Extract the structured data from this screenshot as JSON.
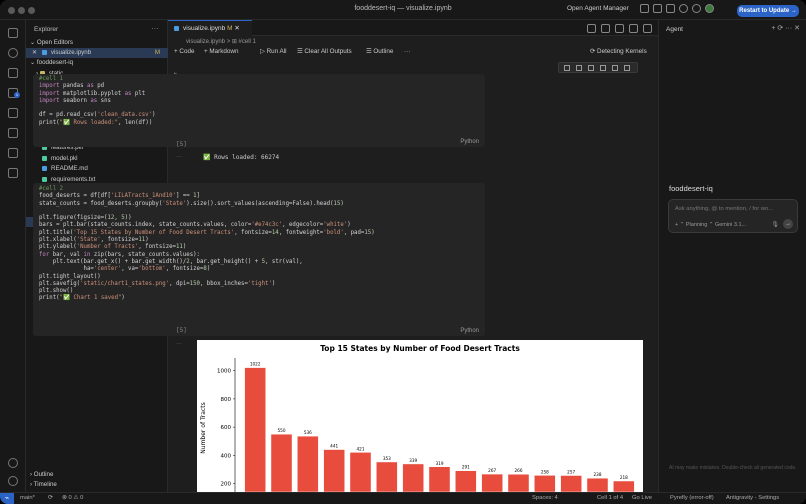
{
  "window_title": "fooddesert-iq — visualize.ipynb",
  "titlebar": {
    "agent_manager": "Open Agent Manager",
    "restart_button": "Restart to Update →"
  },
  "explorer": {
    "header": "Explorer",
    "open_editors": "Open Editors",
    "open_file": "visualize.ipynb",
    "open_file_badge": "M",
    "project": "fooddesert-iq",
    "items": [
      {
        "label": "static",
        "color": "#c8b560"
      },
      {
        "label": "templates",
        "color": "#c8b560"
      },
      {
        "label": "venv",
        "color": "#c8b560"
      },
      {
        "label": ".gitignore",
        "color": "#e06c5a"
      },
      {
        "label": "app.py",
        "color": "#e5c25a"
      },
      {
        "label": "cdc_health.csv",
        "color": "#4ec9a0"
      },
      {
        "label": "clean_data.csv",
        "color": "#4ec9a0"
      },
      {
        "label": "features.pkl",
        "color": "#4ec9a0"
      },
      {
        "label": "model.pkl",
        "color": "#4ec9a0"
      },
      {
        "label": "README.md",
        "color": "#4a9de0"
      },
      {
        "label": "requirements.txt",
        "color": "#4ec9a0"
      },
      {
        "label": "touch build_data.ipynb",
        "color": "#4a9de0"
      },
      {
        "label": "train_model.py",
        "color": "#4ec9a0"
      },
      {
        "label": "usda_food_access.xlsx",
        "color": "#4ec9a0"
      },
      {
        "label": "visualize.ipynb",
        "color": "#4a9de0",
        "badge": "M"
      }
    ],
    "outline": "Outline",
    "timeline": "Timeline"
  },
  "editor": {
    "tab": "visualize.ipynb",
    "tab_badge": "M",
    "breadcrumb": "visualize.ipynb > ⊞ #cell 1",
    "toolbar": {
      "code": "+ Code",
      "markdown": "+ Markdown",
      "run_all": "▷ Run All",
      "clear": "☰ Clear All Outputs",
      "outline": "☰ Outline",
      "more": "···",
      "kernel": "⟳ Detecting Kernels"
    },
    "cell1": {
      "lines": [
        "#cell 1",
        "import pandas as pd",
        "import matplotlib.pyplot as plt",
        "import seaborn as sns",
        "",
        "df = pd.read_csv('clean_data.csv')",
        "print(\"✅ Rows loaded:\", len(df))"
      ],
      "exec": "[5]",
      "lang": "Python",
      "output": "✅ Rows loaded: 66274"
    },
    "cell2": {
      "lines": [
        "#cell 2",
        "food_deserts = df[df['LILATracts_1And10'] == 1]",
        "state_counts = food_deserts.groupby('State').size().sort_values(ascending=False).head(15)",
        "",
        "plt.figure(figsize=(12, 5))",
        "bars = plt.bar(state_counts.index, state_counts.values, color='#e74c3c', edgecolor='white')",
        "plt.title('Top 15 States by Number of Food Desert Tracts', fontsize=14, fontweight='bold', pad=15)",
        "plt.xlabel('State', fontsize=11)",
        "plt.ylabel('Number of Tracts', fontsize=11)",
        "for bar, val in zip(bars, state_counts.values):",
        "    plt.text(bar.get_x() + bar.get_width()/2, bar.get_height() + 5, str(val),",
        "             ha='center', va='bottom', fontsize=8)",
        "plt.tight_layout()",
        "plt.savefig('static/chart1_states.png', dpi=150, bbox_inches='tight')",
        "plt.show()",
        "print(\"✅ Chart 1 saved\")"
      ],
      "exec": "[5]",
      "lang": "Python"
    }
  },
  "chart_data": {
    "type": "bar",
    "title": "Top 15 States by Number of Food Desert Tracts",
    "ylabel": "Number of Tracts",
    "xlabel": "",
    "values": [
      1022,
      550,
      536,
      441,
      421,
      353,
      339,
      319,
      291,
      267,
      266,
      258,
      257,
      238,
      218
    ],
    "yticks": [
      200,
      400,
      600,
      800,
      1000
    ],
    "ylim": [
      140,
      1090
    ],
    "bar_color": "#e74c3c"
  },
  "agent": {
    "header": "Agent",
    "title": "fooddesert-iq",
    "placeholder": "Ask anything, @ to mention, / for wo...",
    "opts": "+  ⌃ Planning   ⌃ Gemini 3.1...",
    "footer": "AI may make mistakes. Double-check all generated code."
  },
  "statusbar": {
    "branch": "main*",
    "sync": "⟳",
    "problems": "⊗ 0 ⚠ 0",
    "spaces": "Spaces: 4",
    "cell": "Cell 1 of 4",
    "golive": "Go Live",
    "pyrefly": "Pyrefly (error-off)",
    "settings": "Antigravity - Settings"
  }
}
